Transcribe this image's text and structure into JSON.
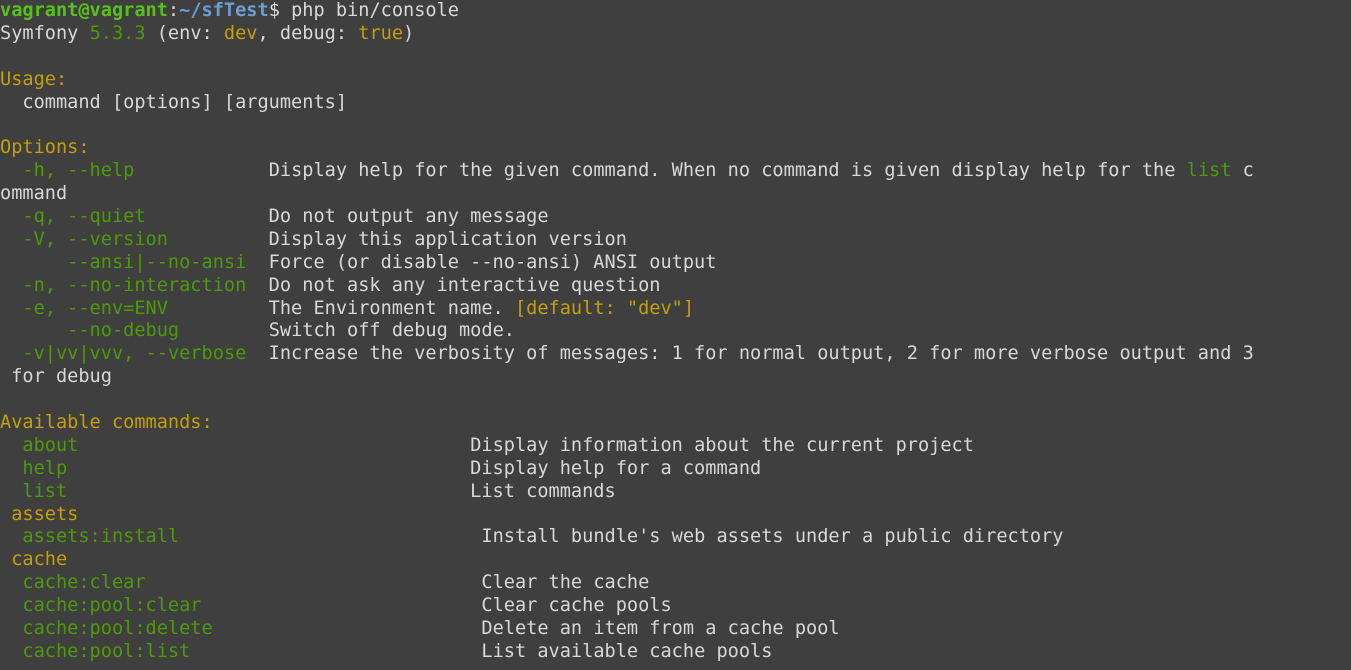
{
  "terminal": {
    "title": "vagrant@vagrant: ~/sfTest",
    "colors": {
      "background": "#3f3f3f",
      "foreground": "#d8d8d8",
      "green": "#4e9a06",
      "bright_green": "#59c14b",
      "yellow": "#c4a000",
      "blue": "#729fcf"
    },
    "prompt": {
      "user_host": "vagrant@vagrant",
      "separator": ":",
      "path": "~/sfTest",
      "sigil": "$",
      "command": " php bin/console"
    },
    "version_line": {
      "app": "Symfony ",
      "version": "5.3.3",
      "open": " (env: ",
      "env": "dev",
      "mid": ", debug: ",
      "debug": "true",
      "close": ")"
    },
    "usage": {
      "header": "Usage:",
      "line": "  command [options] [arguments]"
    },
    "options": {
      "header": "Options:",
      "items": [
        {
          "flags": "  -h, --help",
          "pad": "            ",
          "desc_pre": "Display help for the given command. When no command is given display help for the ",
          "desc_highlight": "list",
          "desc_post": " c",
          "wrap": "ommand"
        },
        {
          "flags": "  -q, --quiet",
          "pad": "           ",
          "desc_pre": "Do not output any message",
          "desc_highlight": "",
          "desc_post": "",
          "wrap": ""
        },
        {
          "flags": "  -V, --version",
          "pad": "         ",
          "desc_pre": "Display this application version",
          "desc_highlight": "",
          "desc_post": "",
          "wrap": ""
        },
        {
          "flags": "      --ansi|--no-ansi",
          "pad": "  ",
          "desc_pre": "Force (or disable --no-ansi) ANSI output",
          "desc_highlight": "",
          "desc_post": "",
          "wrap": ""
        },
        {
          "flags": "  -n, --no-interaction",
          "pad": "  ",
          "desc_pre": "Do not ask any interactive question",
          "desc_highlight": "",
          "desc_post": "",
          "wrap": ""
        },
        {
          "flags": "  -e, --env=ENV",
          "pad": "         ",
          "desc_pre": "The Environment name. ",
          "desc_highlight": "",
          "desc_post": "",
          "wrap": "",
          "default_badge": "[default: \"dev\"]"
        },
        {
          "flags": "      --no-debug",
          "pad": "        ",
          "desc_pre": "Switch off debug mode.",
          "desc_highlight": "",
          "desc_post": "",
          "wrap": ""
        },
        {
          "flags": "  -v|vv|vvv, --verbose",
          "pad": "  ",
          "desc_pre": "Increase the verbosity of messages: 1 for normal output, 2 for more verbose output and 3",
          "desc_highlight": "",
          "desc_post": "",
          "wrap": " for debug"
        }
      ]
    },
    "available_commands": {
      "header": "Available commands:",
      "rows": [
        {
          "kind": "command",
          "name": "  about",
          "pad": "                                   ",
          "desc": "Display information about the current project"
        },
        {
          "kind": "command",
          "name": "  help",
          "pad": "                                    ",
          "desc": "Display help for a command"
        },
        {
          "kind": "command",
          "name": "  list",
          "pad": "                                    ",
          "desc": "List commands"
        },
        {
          "kind": "namespace",
          "name": " assets",
          "pad": "",
          "desc": ""
        },
        {
          "kind": "command",
          "name": "  assets:install",
          "pad": "                           ",
          "desc": "Install bundle's web assets under a public directory"
        },
        {
          "kind": "namespace",
          "name": " cache",
          "pad": "",
          "desc": ""
        },
        {
          "kind": "command",
          "name": "  cache:clear",
          "pad": "                              ",
          "desc": "Clear the cache"
        },
        {
          "kind": "command",
          "name": "  cache:pool:clear",
          "pad": "                         ",
          "desc": "Clear cache pools"
        },
        {
          "kind": "command",
          "name": "  cache:pool:delete",
          "pad": "                        ",
          "desc": "Delete an item from a cache pool"
        },
        {
          "kind": "command",
          "name": "  cache:pool:list",
          "pad": "                          ",
          "desc": "List available cache pools"
        }
      ]
    }
  }
}
